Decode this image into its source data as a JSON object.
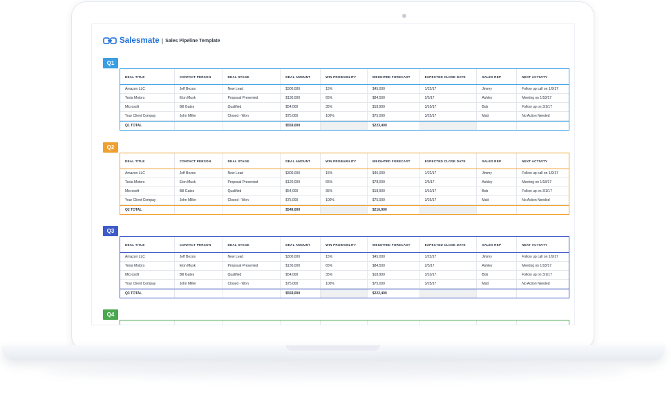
{
  "brand": {
    "name": "Salesmate",
    "separator": "|",
    "subtitle": "Sales Pipeline Template",
    "accent": "#1c6fd8"
  },
  "columns": [
    "DEAL TITLE",
    "CONTACT PERSON",
    "DEAL STAGE",
    "DEAL AMOUNT",
    "WIN PROBABILITY",
    "WEIGHTED FORECAST",
    "EXPECTED CLOSE DATE",
    "SALES REP",
    "NEXT ACTIVITY"
  ],
  "quarters": [
    {
      "label": "Q1",
      "color": "#3a9ee4",
      "rows": [
        [
          "Amazon LLC",
          "Jeff Bezos",
          "New Lead",
          "$300,000",
          "15%",
          "$45,000",
          "1/22/17",
          "Jimmy",
          "Follow up call on 1/9/17"
        ],
        [
          "Tesla Motors",
          "Elon Musk",
          "Proposal Presented",
          "$130,000",
          "65%",
          "$84,500",
          "2/5/17",
          "Ashley",
          "Meeting on 1/18/17"
        ],
        [
          "Microsoft",
          "Bill Gates",
          "Qualified",
          "$54,000",
          "35%",
          "$18,900",
          "3/10/17",
          "Bob",
          "Follow up on 3/1/17"
        ],
        [
          "Your Client Compay",
          "John Miller",
          "Closed - Won",
          "$75,000",
          "100%",
          "$75,000",
          "3/25/17",
          "Matt",
          "No Action Needed"
        ]
      ],
      "total": {
        "label": "Q1 TOTAL",
        "amount": "$559,000",
        "forecast": "$223,400"
      }
    },
    {
      "label": "Q2",
      "color": "#f0a030",
      "rows": [
        [
          "Amazon LLC",
          "Jeff Bezos",
          "New Lead",
          "$300,000",
          "15%",
          "$45,000",
          "1/22/17",
          "Jimmy",
          "Follow up call on 1/9/17"
        ],
        [
          "Tesla Motors",
          "Elon Musk",
          "Proposal Presented",
          "$120,000",
          "65%",
          "$78,000",
          "2/5/17",
          "Ashley",
          "Meeting on 1/18/17"
        ],
        [
          "Microsoft",
          "Bill Gates",
          "Qualified",
          "$54,000",
          "35%",
          "$18,900",
          "3/10/17",
          "Bob",
          "Follow up on 3/1/17"
        ],
        [
          "Your Client Compay",
          "John Miller",
          "Closed - Won",
          "$75,000",
          "100%",
          "$75,000",
          "3/25/17",
          "Matt",
          "No Action Needed"
        ]
      ],
      "total": {
        "label": "Q2 TOTAL",
        "amount": "$549,000",
        "forecast": "$216,900"
      }
    },
    {
      "label": "Q3",
      "color": "#3f5bc9",
      "rows": [
        [
          "Amazon LLC",
          "Jeff Bezos",
          "New Lead",
          "$300,000",
          "15%",
          "$45,000",
          "1/22/17",
          "Jimmy",
          "Follow up call on 1/9/17"
        ],
        [
          "Tesla Motors",
          "Elon Musk",
          "Proposal Presented",
          "$130,000",
          "65%",
          "$84,500",
          "2/5/17",
          "Ashley",
          "Meeting on 1/18/17"
        ],
        [
          "Microsoft",
          "Bill Gates",
          "Qualified",
          "$54,000",
          "35%",
          "$18,900",
          "3/10/17",
          "Bob",
          "Follow up on 3/1/17"
        ],
        [
          "Your Client Compay",
          "John Miller",
          "Closed - Won",
          "$75,000",
          "100%",
          "$75,000",
          "3/25/17",
          "Matt",
          "No Action Needed"
        ]
      ],
      "total": {
        "label": "Q3 TOTAL",
        "amount": "$559,000",
        "forecast": "$222,400"
      }
    },
    {
      "label": "Q4",
      "color": "#4aa84e",
      "rows": [],
      "total": null
    }
  ]
}
